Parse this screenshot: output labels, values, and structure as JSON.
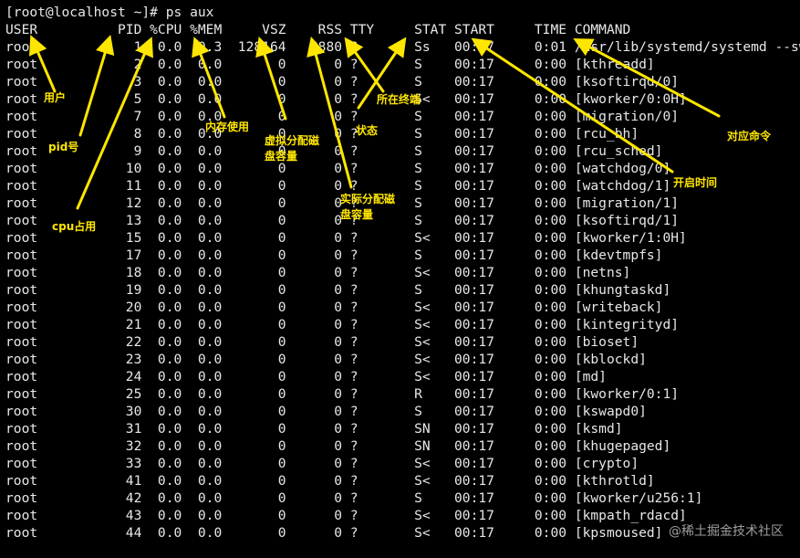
{
  "terminal": {
    "prompt": "[root@localhost ~]# ps aux",
    "header": [
      "USER",
      "PID",
      "%CPU",
      "%MEM",
      "VSZ",
      "RSS",
      "TTY",
      "STAT",
      "START",
      "TIME",
      "COMMAND"
    ],
    "rows": [
      [
        "root",
        "1",
        "0.0",
        "0.3",
        "128164",
        "6880",
        "?",
        "Ss",
        "00:17",
        "0:01",
        "/usr/lib/systemd/systemd --swi"
      ],
      [
        "root",
        "2",
        "0.0",
        "0.0",
        "0",
        "0",
        "?",
        "S",
        "00:17",
        "0:00",
        "[kthreadd]"
      ],
      [
        "root",
        "3",
        "0.0",
        "0.0",
        "0",
        "0",
        "?",
        "S",
        "00:17",
        "0:00",
        "[ksoftirqd/0]"
      ],
      [
        "root",
        "5",
        "0.0",
        "0.0",
        "0",
        "0",
        "?",
        "S<",
        "00:17",
        "0:00",
        "[kworker/0:0H]"
      ],
      [
        "root",
        "7",
        "0.0",
        "0.0",
        "0",
        "0",
        "?",
        "S",
        "00:17",
        "0:00",
        "[migration/0]"
      ],
      [
        "root",
        "8",
        "0.0",
        "0.0",
        "0",
        "0",
        "?",
        "S",
        "00:17",
        "0:00",
        "[rcu_bh]"
      ],
      [
        "root",
        "9",
        "0.0",
        "0.0",
        "0",
        "0",
        "?",
        "S",
        "00:17",
        "0:00",
        "[rcu_sched]"
      ],
      [
        "root",
        "10",
        "0.0",
        "0.0",
        "0",
        "0",
        "?",
        "S",
        "00:17",
        "0:00",
        "[watchdog/0]"
      ],
      [
        "root",
        "11",
        "0.0",
        "0.0",
        "0",
        "0",
        "?",
        "S",
        "00:17",
        "0:00",
        "[watchdog/1]"
      ],
      [
        "root",
        "12",
        "0.0",
        "0.0",
        "0",
        "0",
        "?",
        "S",
        "00:17",
        "0:00",
        "[migration/1]"
      ],
      [
        "root",
        "13",
        "0.0",
        "0.0",
        "0",
        "0",
        "?",
        "S",
        "00:17",
        "0:00",
        "[ksoftirqd/1]"
      ],
      [
        "root",
        "15",
        "0.0",
        "0.0",
        "0",
        "0",
        "?",
        "S<",
        "00:17",
        "0:00",
        "[kworker/1:0H]"
      ],
      [
        "root",
        "17",
        "0.0",
        "0.0",
        "0",
        "0",
        "?",
        "S",
        "00:17",
        "0:00",
        "[kdevtmpfs]"
      ],
      [
        "root",
        "18",
        "0.0",
        "0.0",
        "0",
        "0",
        "?",
        "S<",
        "00:17",
        "0:00",
        "[netns]"
      ],
      [
        "root",
        "19",
        "0.0",
        "0.0",
        "0",
        "0",
        "?",
        "S",
        "00:17",
        "0:00",
        "[khungtaskd]"
      ],
      [
        "root",
        "20",
        "0.0",
        "0.0",
        "0",
        "0",
        "?",
        "S<",
        "00:17",
        "0:00",
        "[writeback]"
      ],
      [
        "root",
        "21",
        "0.0",
        "0.0",
        "0",
        "0",
        "?",
        "S<",
        "00:17",
        "0:00",
        "[kintegrityd]"
      ],
      [
        "root",
        "22",
        "0.0",
        "0.0",
        "0",
        "0",
        "?",
        "S<",
        "00:17",
        "0:00",
        "[bioset]"
      ],
      [
        "root",
        "23",
        "0.0",
        "0.0",
        "0",
        "0",
        "?",
        "S<",
        "00:17",
        "0:00",
        "[kblockd]"
      ],
      [
        "root",
        "24",
        "0.0",
        "0.0",
        "0",
        "0",
        "?",
        "S<",
        "00:17",
        "0:00",
        "[md]"
      ],
      [
        "root",
        "25",
        "0.0",
        "0.0",
        "0",
        "0",
        "?",
        "R",
        "00:17",
        "0:00",
        "[kworker/0:1]"
      ],
      [
        "root",
        "30",
        "0.0",
        "0.0",
        "0",
        "0",
        "?",
        "S",
        "00:17",
        "0:00",
        "[kswapd0]"
      ],
      [
        "root",
        "31",
        "0.0",
        "0.0",
        "0",
        "0",
        "?",
        "SN",
        "00:17",
        "0:00",
        "[ksmd]"
      ],
      [
        "root",
        "32",
        "0.0",
        "0.0",
        "0",
        "0",
        "?",
        "SN",
        "00:17",
        "0:00",
        "[khugepaged]"
      ],
      [
        "root",
        "33",
        "0.0",
        "0.0",
        "0",
        "0",
        "?",
        "S<",
        "00:17",
        "0:00",
        "[crypto]"
      ],
      [
        "root",
        "41",
        "0.0",
        "0.0",
        "0",
        "0",
        "?",
        "S<",
        "00:17",
        "0:00",
        "[kthrotld]"
      ],
      [
        "root",
        "42",
        "0.0",
        "0.0",
        "0",
        "0",
        "?",
        "S",
        "00:17",
        "0:00",
        "[kworker/u256:1]"
      ],
      [
        "root",
        "43",
        "0.0",
        "0.0",
        "0",
        "0",
        "?",
        "S<",
        "00:17",
        "0:00",
        "[kmpath_rdacd]"
      ],
      [
        "root",
        "44",
        "0.0",
        "0.0",
        "0",
        "0",
        "?",
        "S<",
        "00:17",
        "0:00",
        "[kpsmoused]"
      ]
    ]
  },
  "annotations": {
    "user": "用户",
    "pid": "pid号",
    "cpu": "cpu占用",
    "mem": "内存使用",
    "vsz": "虚拟分配磁盘容量",
    "rss": "实际分配磁盘容量",
    "stat": "状态",
    "tty": "所在终端",
    "start": "开启时间",
    "command": "对应命令"
  },
  "watermark": "@稀土掘金技术社区",
  "colors": {
    "background": "#000000",
    "text": "#e8e8e8",
    "annotation": "#ffe600"
  }
}
